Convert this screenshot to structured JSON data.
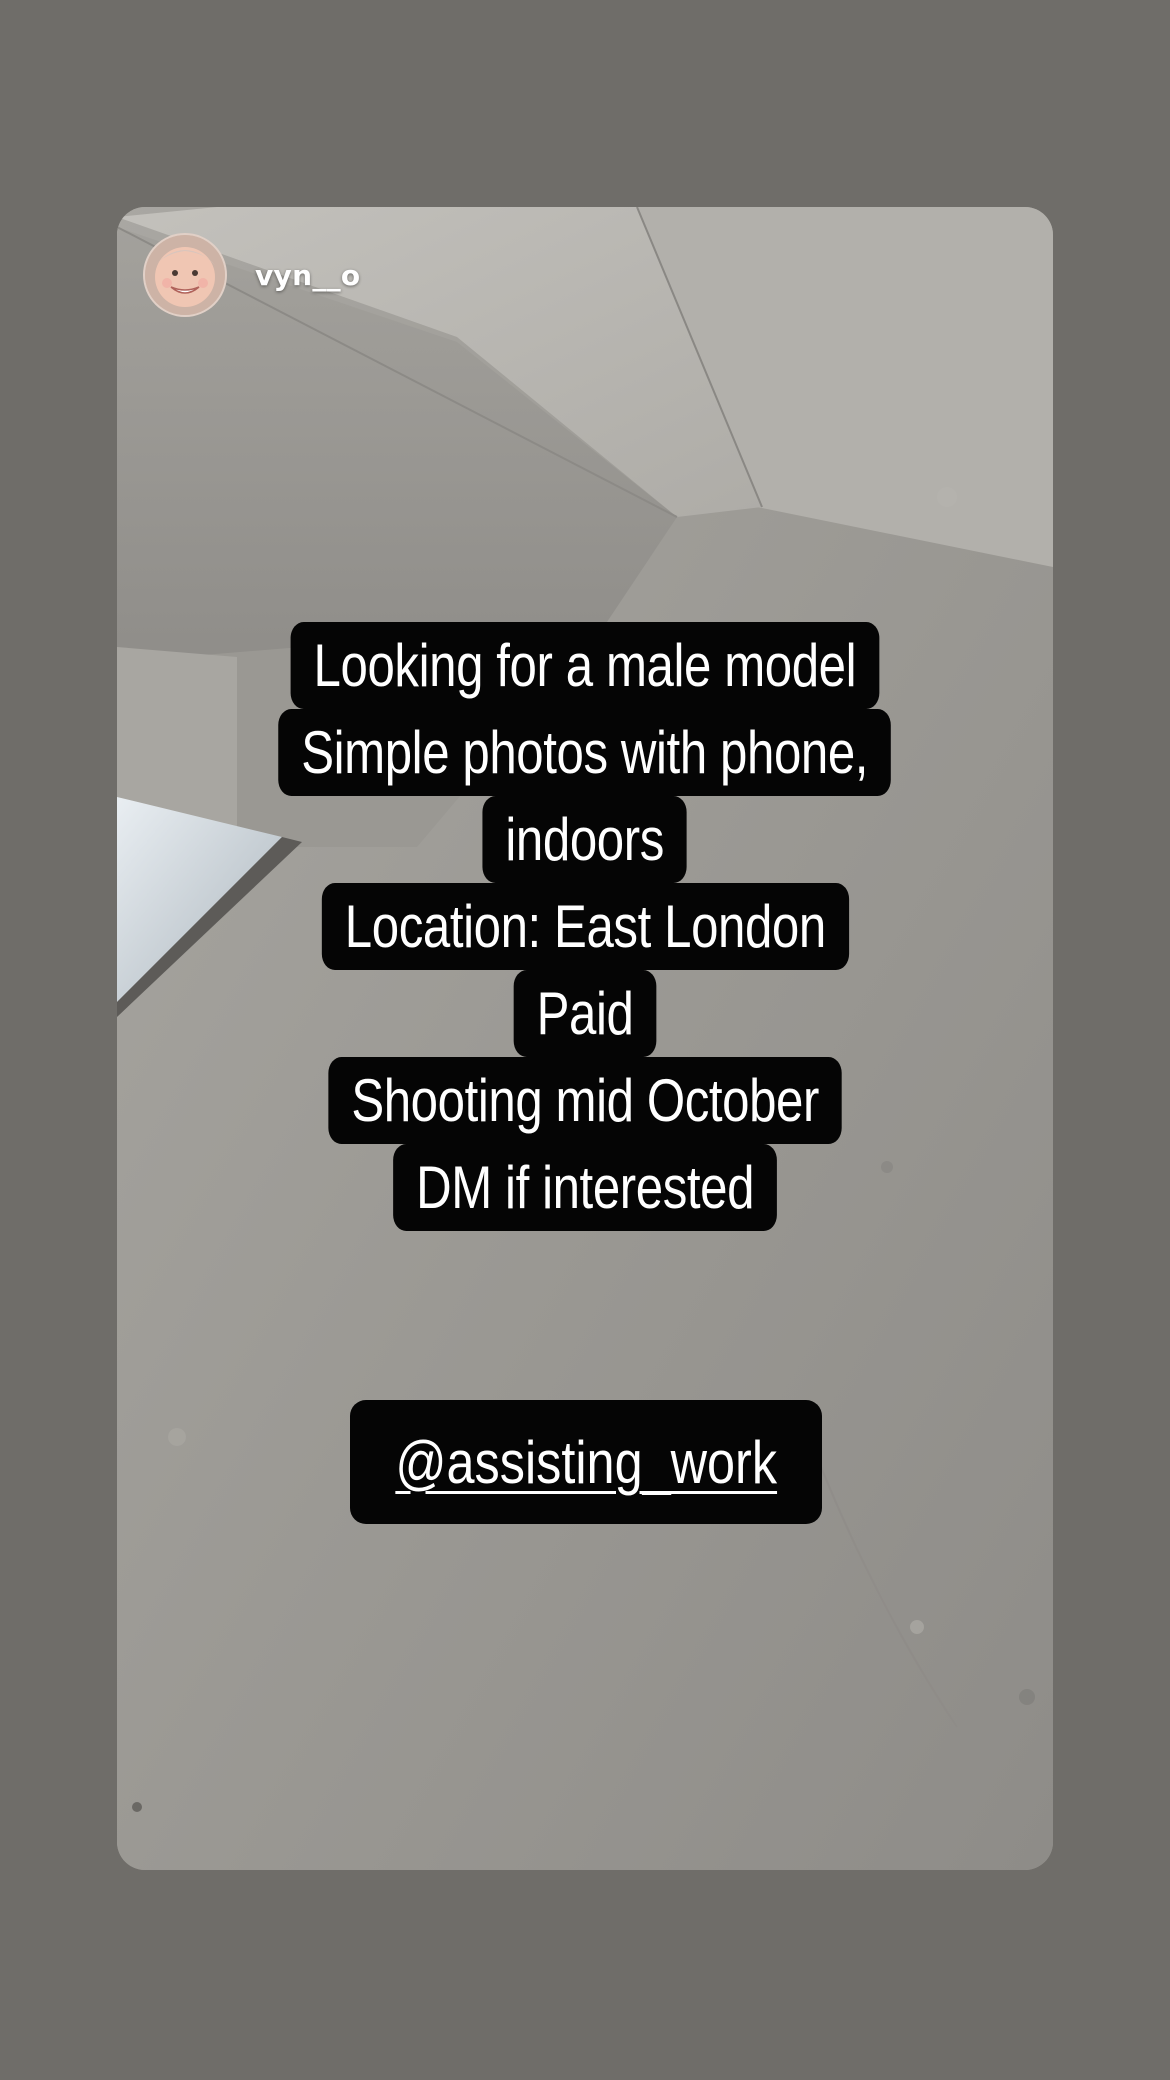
{
  "story": {
    "username": "vyn__o",
    "caption_lines": [
      "Looking for a male model",
      "Simple photos with phone,",
      "indoors",
      "Location: East London",
      "Paid",
      "Shooting mid October",
      "DM if interested"
    ],
    "mention": "@assisting_work"
  },
  "colors": {
    "background": "#6f6d69",
    "caption_box": "#050505",
    "text": "#ffffff"
  },
  "icons": {
    "avatar": "profile-photo"
  }
}
